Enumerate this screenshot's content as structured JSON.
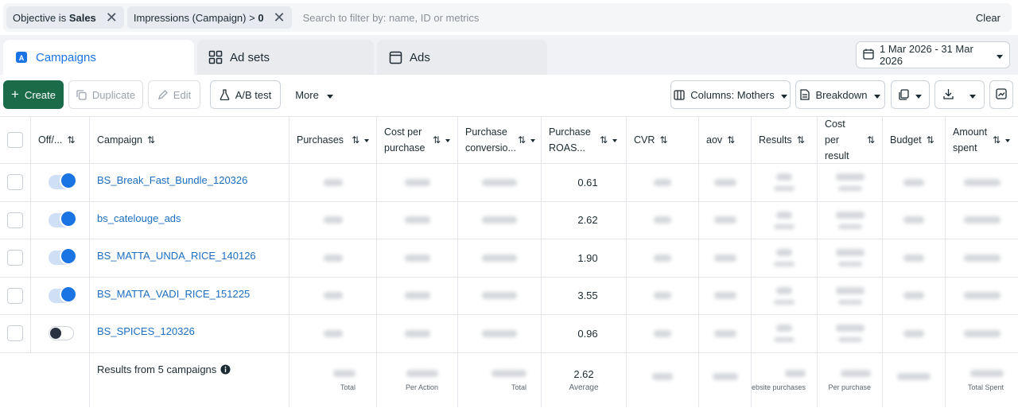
{
  "filters": [
    {
      "prefix": "Objective is ",
      "value": "Sales"
    },
    {
      "prefix": "Impressions (Campaign) > ",
      "value": "0"
    }
  ],
  "search": {
    "placeholder": "Search to filter by: name, ID or metrics"
  },
  "clear_label": "Clear",
  "tabs": [
    {
      "label": "Campaigns",
      "icon": "campaign-icon",
      "active": true
    },
    {
      "label": "Ad sets",
      "icon": "grid-icon",
      "active": false
    },
    {
      "label": "Ads",
      "icon": "ad-icon",
      "active": false
    }
  ],
  "date_range": "1 Mar 2026 - 31 Mar 2026",
  "toolbar": {
    "create": "Create",
    "duplicate": "Duplicate",
    "edit": "Edit",
    "ab_test": "A/B test",
    "more": "More",
    "columns": "Columns: Mothers",
    "breakdown": "Breakdown"
  },
  "columns": [
    {
      "key": "toggle",
      "label": "Off/..."
    },
    {
      "key": "campaign",
      "label": "Campaign"
    },
    {
      "key": "purchases",
      "label": "Purchases"
    },
    {
      "key": "cost_per_purchase",
      "label": "Cost per purchase"
    },
    {
      "key": "purchase_conversion",
      "label": "Purchase conversio..."
    },
    {
      "key": "purchase_roas",
      "label": "Purchase ROAS..."
    },
    {
      "key": "cvr",
      "label": "CVR"
    },
    {
      "key": "aov",
      "label": "aov"
    },
    {
      "key": "results",
      "label": "Results"
    },
    {
      "key": "cost_per_result",
      "label": "Cost per result"
    },
    {
      "key": "budget",
      "label": "Budget"
    },
    {
      "key": "amount_spent",
      "label": "Amount spent"
    }
  ],
  "rows": [
    {
      "name": "BS_Break_Fast_Bundle_120326",
      "on": true,
      "roas": "0.61"
    },
    {
      "name": "bs_catelouge_ads",
      "on": true,
      "roas": "2.62"
    },
    {
      "name": "BS_MATTA_UNDA_RICE_140126",
      "on": true,
      "roas": "1.90"
    },
    {
      "name": "BS_MATTA_VADI_RICE_151225",
      "on": true,
      "roas": "3.55"
    },
    {
      "name": "BS_SPICES_120326",
      "on": false,
      "roas": "0.96"
    }
  ],
  "footer": {
    "label": "Results from 5 campaigns",
    "roas": "2.62",
    "roas_sub": "Average",
    "purchases_sub": "Total",
    "cost_per_purchase_sub": "Per Action",
    "conversion_sub": "Total",
    "results_sub": "ebsite purchases",
    "cost_per_result_sub": "Per purchase",
    "amount_spent_sub": "Total Spent"
  },
  "colors": {
    "accent": "#1b74e4",
    "create": "#1b6b49",
    "link": "#1b6ec2"
  }
}
